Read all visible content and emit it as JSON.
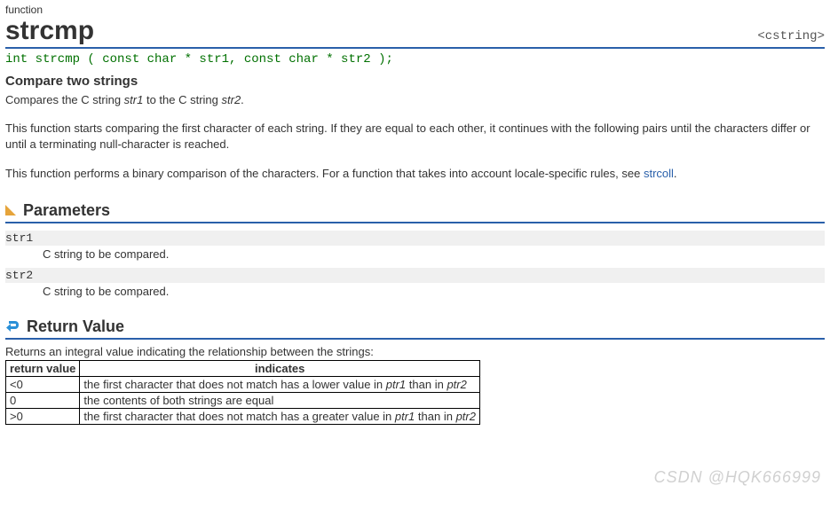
{
  "category": "function",
  "title": "strcmp",
  "header_include": "<cstring>",
  "prototype": "int strcmp ( const char * str1, const char * str2 );",
  "subtitle": "Compare two strings",
  "desc1_pre": "Compares the C string ",
  "desc1_em1": "str1",
  "desc1_mid": " to the C string ",
  "desc1_em2": "str2",
  "desc1_post": ".",
  "desc2": "This function starts comparing the first character of each string. If they are equal to each other, it continues with the following pairs until the characters differ or until a terminating null-character is reached.",
  "desc3_pre": "This function performs a binary comparison of the characters. For a function that takes into account locale-specific rules, see ",
  "desc3_link": "strcoll",
  "desc3_post": ".",
  "section_params": "Parameters",
  "params": [
    {
      "name": "str1",
      "desc": "C string to be compared."
    },
    {
      "name": "str2",
      "desc": "C string to be compared."
    }
  ],
  "section_return": "Return Value",
  "return_intro": "Returns an integral value indicating the relationship between the strings:",
  "table_headers": {
    "col1": "return value",
    "col2": "indicates"
  },
  "chart_data": {
    "type": "table",
    "title": "Return value meaning",
    "columns": [
      "return value",
      "indicates"
    ],
    "rows": [
      {
        "value": "<0",
        "text_pre": "the first character that does not match has a lower value in ",
        "em1": "ptr1",
        "text_mid": " than in ",
        "em2": "ptr2"
      },
      {
        "value": "0",
        "text_pre": "the contents of both strings are equal",
        "em1": "",
        "text_mid": "",
        "em2": ""
      },
      {
        "value": ">0",
        "text_pre": "the first character that does not match has a greater value in ",
        "em1": "ptr1",
        "text_mid": " than in ",
        "em2": "ptr2"
      }
    ]
  },
  "watermark": "CSDN @HQK666999"
}
